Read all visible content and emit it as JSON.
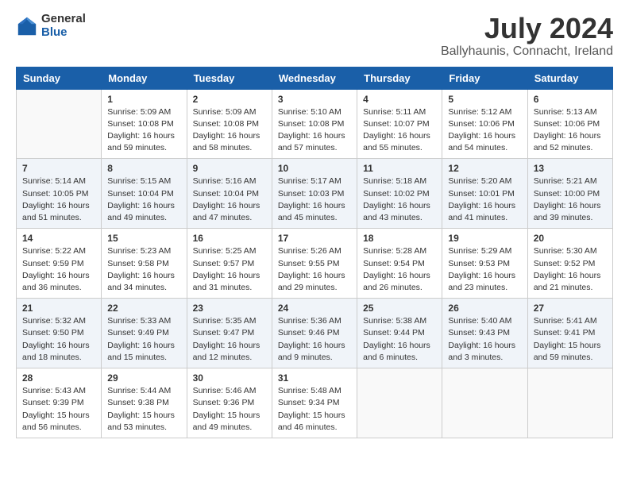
{
  "logo": {
    "general": "General",
    "blue": "Blue"
  },
  "title": "July 2024",
  "subtitle": "Ballyhaunis, Connacht, Ireland",
  "headers": [
    "Sunday",
    "Monday",
    "Tuesday",
    "Wednesday",
    "Thursday",
    "Friday",
    "Saturday"
  ],
  "weeks": [
    [
      {
        "day": "",
        "info": ""
      },
      {
        "day": "1",
        "info": "Sunrise: 5:09 AM\nSunset: 10:08 PM\nDaylight: 16 hours\nand 59 minutes."
      },
      {
        "day": "2",
        "info": "Sunrise: 5:09 AM\nSunset: 10:08 PM\nDaylight: 16 hours\nand 58 minutes."
      },
      {
        "day": "3",
        "info": "Sunrise: 5:10 AM\nSunset: 10:08 PM\nDaylight: 16 hours\nand 57 minutes."
      },
      {
        "day": "4",
        "info": "Sunrise: 5:11 AM\nSunset: 10:07 PM\nDaylight: 16 hours\nand 55 minutes."
      },
      {
        "day": "5",
        "info": "Sunrise: 5:12 AM\nSunset: 10:06 PM\nDaylight: 16 hours\nand 54 minutes."
      },
      {
        "day": "6",
        "info": "Sunrise: 5:13 AM\nSunset: 10:06 PM\nDaylight: 16 hours\nand 52 minutes."
      }
    ],
    [
      {
        "day": "7",
        "info": "Sunrise: 5:14 AM\nSunset: 10:05 PM\nDaylight: 16 hours\nand 51 minutes."
      },
      {
        "day": "8",
        "info": "Sunrise: 5:15 AM\nSunset: 10:04 PM\nDaylight: 16 hours\nand 49 minutes."
      },
      {
        "day": "9",
        "info": "Sunrise: 5:16 AM\nSunset: 10:04 PM\nDaylight: 16 hours\nand 47 minutes."
      },
      {
        "day": "10",
        "info": "Sunrise: 5:17 AM\nSunset: 10:03 PM\nDaylight: 16 hours\nand 45 minutes."
      },
      {
        "day": "11",
        "info": "Sunrise: 5:18 AM\nSunset: 10:02 PM\nDaylight: 16 hours\nand 43 minutes."
      },
      {
        "day": "12",
        "info": "Sunrise: 5:20 AM\nSunset: 10:01 PM\nDaylight: 16 hours\nand 41 minutes."
      },
      {
        "day": "13",
        "info": "Sunrise: 5:21 AM\nSunset: 10:00 PM\nDaylight: 16 hours\nand 39 minutes."
      }
    ],
    [
      {
        "day": "14",
        "info": "Sunrise: 5:22 AM\nSunset: 9:59 PM\nDaylight: 16 hours\nand 36 minutes."
      },
      {
        "day": "15",
        "info": "Sunrise: 5:23 AM\nSunset: 9:58 PM\nDaylight: 16 hours\nand 34 minutes."
      },
      {
        "day": "16",
        "info": "Sunrise: 5:25 AM\nSunset: 9:57 PM\nDaylight: 16 hours\nand 31 minutes."
      },
      {
        "day": "17",
        "info": "Sunrise: 5:26 AM\nSunset: 9:55 PM\nDaylight: 16 hours\nand 29 minutes."
      },
      {
        "day": "18",
        "info": "Sunrise: 5:28 AM\nSunset: 9:54 PM\nDaylight: 16 hours\nand 26 minutes."
      },
      {
        "day": "19",
        "info": "Sunrise: 5:29 AM\nSunset: 9:53 PM\nDaylight: 16 hours\nand 23 minutes."
      },
      {
        "day": "20",
        "info": "Sunrise: 5:30 AM\nSunset: 9:52 PM\nDaylight: 16 hours\nand 21 minutes."
      }
    ],
    [
      {
        "day": "21",
        "info": "Sunrise: 5:32 AM\nSunset: 9:50 PM\nDaylight: 16 hours\nand 18 minutes."
      },
      {
        "day": "22",
        "info": "Sunrise: 5:33 AM\nSunset: 9:49 PM\nDaylight: 16 hours\nand 15 minutes."
      },
      {
        "day": "23",
        "info": "Sunrise: 5:35 AM\nSunset: 9:47 PM\nDaylight: 16 hours\nand 12 minutes."
      },
      {
        "day": "24",
        "info": "Sunrise: 5:36 AM\nSunset: 9:46 PM\nDaylight: 16 hours\nand 9 minutes."
      },
      {
        "day": "25",
        "info": "Sunrise: 5:38 AM\nSunset: 9:44 PM\nDaylight: 16 hours\nand 6 minutes."
      },
      {
        "day": "26",
        "info": "Sunrise: 5:40 AM\nSunset: 9:43 PM\nDaylight: 16 hours\nand 3 minutes."
      },
      {
        "day": "27",
        "info": "Sunrise: 5:41 AM\nSunset: 9:41 PM\nDaylight: 15 hours\nand 59 minutes."
      }
    ],
    [
      {
        "day": "28",
        "info": "Sunrise: 5:43 AM\nSunset: 9:39 PM\nDaylight: 15 hours\nand 56 minutes."
      },
      {
        "day": "29",
        "info": "Sunrise: 5:44 AM\nSunset: 9:38 PM\nDaylight: 15 hours\nand 53 minutes."
      },
      {
        "day": "30",
        "info": "Sunrise: 5:46 AM\nSunset: 9:36 PM\nDaylight: 15 hours\nand 49 minutes."
      },
      {
        "day": "31",
        "info": "Sunrise: 5:48 AM\nSunset: 9:34 PM\nDaylight: 15 hours\nand 46 minutes."
      },
      {
        "day": "",
        "info": ""
      },
      {
        "day": "",
        "info": ""
      },
      {
        "day": "",
        "info": ""
      }
    ]
  ]
}
